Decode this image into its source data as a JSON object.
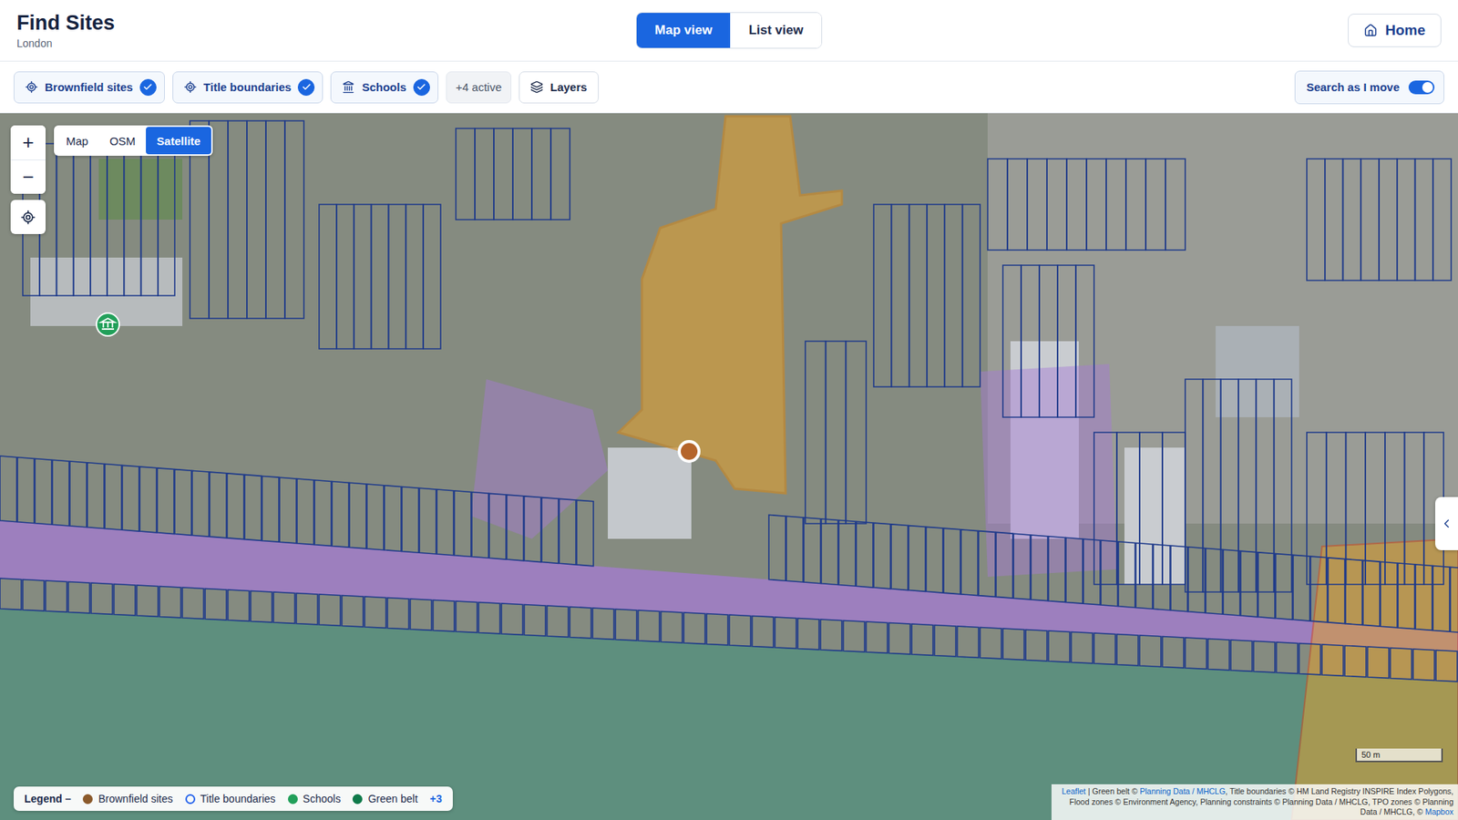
{
  "header": {
    "title": "Find Sites",
    "subtitle": "London",
    "views": [
      {
        "label": "Map view",
        "selected": true
      },
      {
        "label": "List view",
        "selected": false
      }
    ],
    "home_button": "Home"
  },
  "filters": {
    "chips": [
      {
        "label": "Brownfield sites",
        "checked": true,
        "kind": "target"
      },
      {
        "label": "Title boundaries",
        "checked": true,
        "kind": "target"
      },
      {
        "label": "Schools",
        "checked": true,
        "kind": "school"
      }
    ],
    "more": "+4 active",
    "layers_button": "Layers",
    "search_toggle": {
      "label": "Search as I move",
      "on": true
    }
  },
  "map": {
    "zoom_in": "+",
    "zoom_out": "−",
    "base_layers": [
      {
        "label": "Map",
        "selected": false
      },
      {
        "label": "OSM",
        "selected": false
      },
      {
        "label": "Satellite",
        "selected": true
      }
    ],
    "scale": "50 m",
    "attribution": [
      {
        "text": "Leaflet",
        "link": true
      },
      {
        "text": " | Green belt © ",
        "link": false
      },
      {
        "text": "Planning Data / MHCLG",
        "link": true
      },
      {
        "text": ", Title boundaries © HM Land Registry INSPIRE Index Polygons, Flood zones © Environment Agency, Planning constraints © Planning Data / MHCLG, TPO zones © Planning Data / MHCLG, © ",
        "link": false
      },
      {
        "text": "Mapbox",
        "link": true
      }
    ]
  },
  "legend": {
    "title": "Legend –",
    "items": [
      {
        "label": "Brownfield sites",
        "kind": "dot",
        "color": "#8b5a2b"
      },
      {
        "label": "Title boundaries",
        "kind": "ring",
        "color": "#2563eb"
      },
      {
        "label": "Schools",
        "kind": "dot",
        "color": "#22a05a"
      },
      {
        "label": "Green belt",
        "kind": "dot",
        "color": "#0f7a4a"
      }
    ],
    "more": "+3"
  }
}
